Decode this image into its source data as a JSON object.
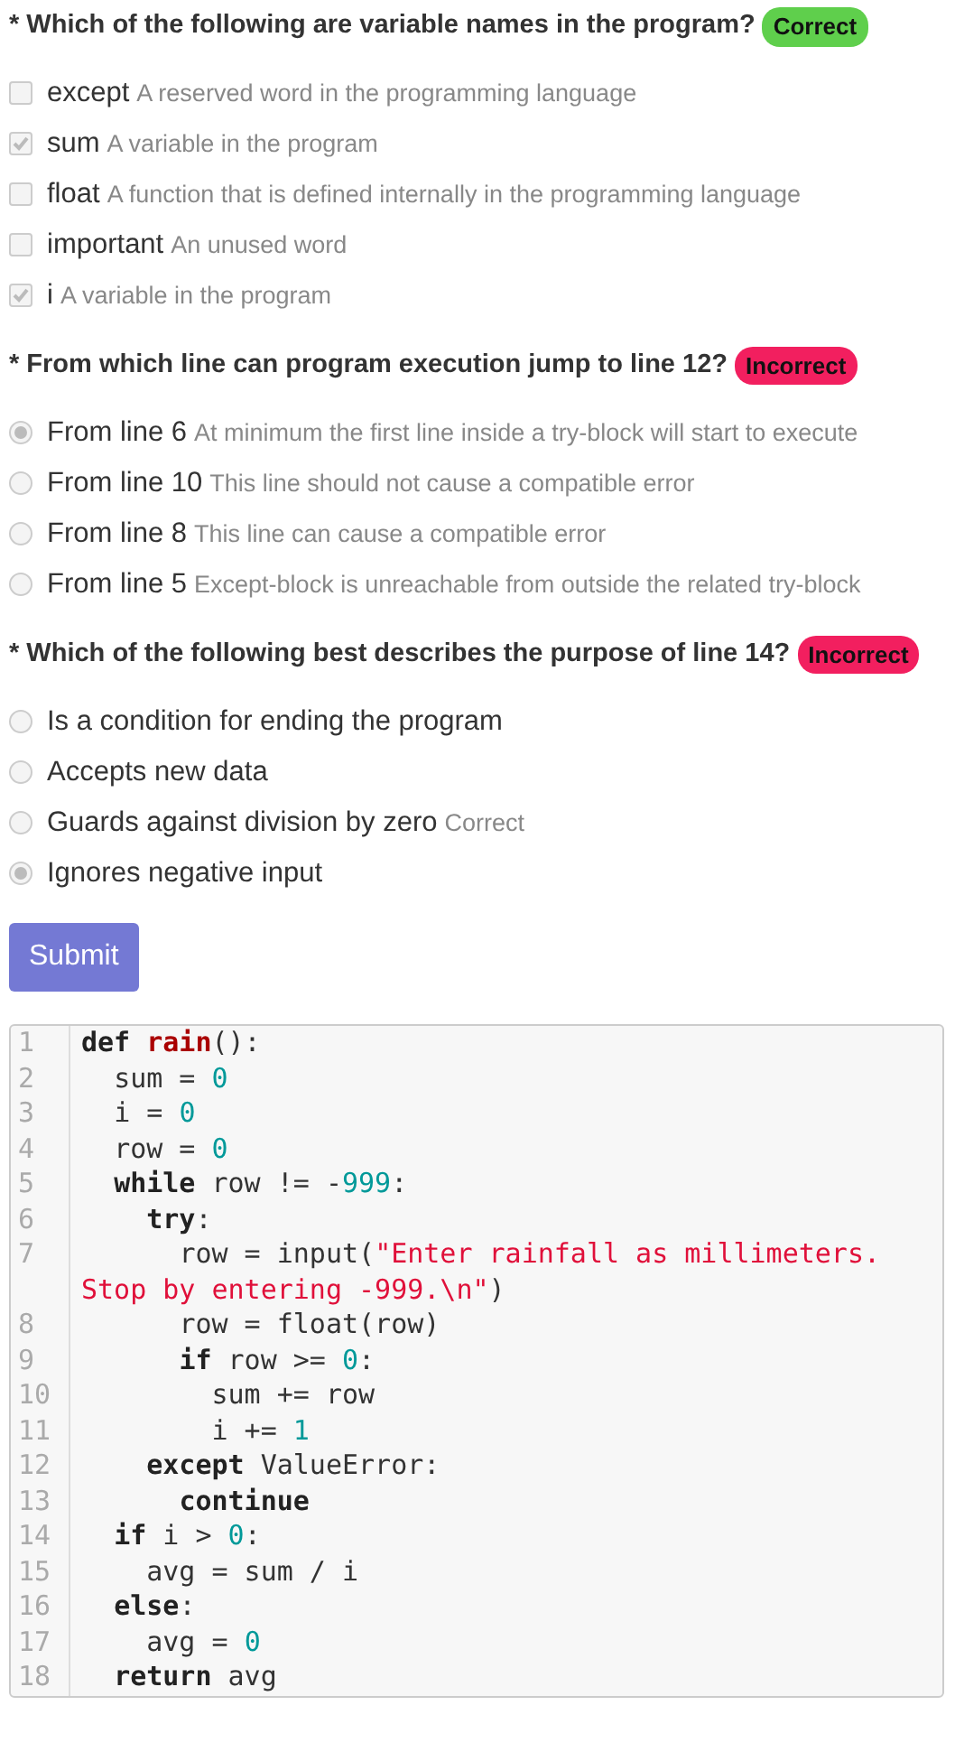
{
  "questions": [
    {
      "prompt": "* Which of the following are variable names in the program?",
      "correct": true,
      "result_label": "Correct",
      "kind": "checkbox",
      "options": [
        {
          "label": "except",
          "feedback": "A reserved word in the programming language",
          "selected": false
        },
        {
          "label": "sum",
          "feedback": "A variable in the program",
          "selected": true
        },
        {
          "label": "float",
          "feedback": "A function that is defined internally in the programming language",
          "selected": false
        },
        {
          "label": "important",
          "feedback": "An unused word",
          "selected": false
        },
        {
          "label": "i",
          "feedback": "A variable in the program",
          "selected": true
        }
      ]
    },
    {
      "prompt": "* From which line can program execution jump to line 12?",
      "correct": false,
      "result_label": "Incorrect",
      "kind": "radio",
      "options": [
        {
          "label": "From line 6",
          "feedback": "At minimum the first line inside a try-block will start to execute",
          "selected": true
        },
        {
          "label": "From line 10",
          "feedback": "This line should not cause a compatible error",
          "selected": false
        },
        {
          "label": "From line 8",
          "feedback": "This line can cause a compatible error",
          "selected": false
        },
        {
          "label": "From line 5",
          "feedback": "Except-block is unreachable from outside the related try-block",
          "selected": false
        }
      ]
    },
    {
      "prompt": "* Which of the following best describes the purpose of line 14?",
      "correct": false,
      "result_label": "Incorrect",
      "kind": "radio",
      "options": [
        {
          "label": "Is a condition for ending the program",
          "selected": false
        },
        {
          "label": "Accepts new data",
          "selected": false
        },
        {
          "label": "Guards against division by zero",
          "feedback": "Correct",
          "selected": false
        },
        {
          "label": "Ignores negative input",
          "selected": true
        }
      ]
    }
  ],
  "submit_button": "Submit",
  "code": [
    {
      "n": "1",
      "tokens": [
        {
          "kind": "keyword",
          "text": "def "
        },
        {
          "kind": "function",
          "text": "rain"
        },
        {
          "kind": "plain",
          "text": "():"
        }
      ]
    },
    {
      "n": "2",
      "tokens": [
        {
          "kind": "plain",
          "text": "  sum = "
        },
        {
          "kind": "number",
          "text": "0"
        }
      ]
    },
    {
      "n": "3",
      "tokens": [
        {
          "kind": "plain",
          "text": "  i = "
        },
        {
          "kind": "number",
          "text": "0"
        }
      ]
    },
    {
      "n": "4",
      "tokens": [
        {
          "kind": "plain",
          "text": "  row = "
        },
        {
          "kind": "number",
          "text": "0"
        }
      ]
    },
    {
      "n": "5",
      "tokens": [
        {
          "kind": "keyword",
          "text": "  while"
        },
        {
          "kind": "plain",
          "text": " row != -"
        },
        {
          "kind": "number",
          "text": "999"
        },
        {
          "kind": "plain",
          "text": ":"
        }
      ]
    },
    {
      "n": "6",
      "tokens": [
        {
          "kind": "keyword",
          "text": "    try"
        },
        {
          "kind": "plain",
          "text": ":"
        }
      ]
    },
    {
      "n": "7",
      "tokens": [
        {
          "kind": "plain",
          "text": "      row = input("
        },
        {
          "kind": "string",
          "text": "\"Enter rainfall as millimeters. Stop by entering -999.\\n\""
        },
        {
          "kind": "plain",
          "text": ")"
        }
      ]
    },
    {
      "n": "8",
      "tokens": [
        {
          "kind": "plain",
          "text": "      row = float(row)"
        }
      ]
    },
    {
      "n": "9",
      "tokens": [
        {
          "kind": "keyword",
          "text": "      if"
        },
        {
          "kind": "plain",
          "text": " row >= "
        },
        {
          "kind": "number",
          "text": "0"
        },
        {
          "kind": "plain",
          "text": ":"
        }
      ]
    },
    {
      "n": "10",
      "tokens": [
        {
          "kind": "plain",
          "text": "        sum += row"
        }
      ]
    },
    {
      "n": "11",
      "tokens": [
        {
          "kind": "plain",
          "text": "        i += "
        },
        {
          "kind": "number",
          "text": "1"
        }
      ]
    },
    {
      "n": "12",
      "tokens": [
        {
          "kind": "keyword",
          "text": "    except"
        },
        {
          "kind": "plain",
          "text": " ValueError:"
        }
      ]
    },
    {
      "n": "13",
      "tokens": [
        {
          "kind": "keyword",
          "text": "      continue"
        }
      ]
    },
    {
      "n": "14",
      "tokens": [
        {
          "kind": "keyword",
          "text": "  if"
        },
        {
          "kind": "plain",
          "text": " i > "
        },
        {
          "kind": "number",
          "text": "0"
        },
        {
          "kind": "plain",
          "text": ":"
        }
      ]
    },
    {
      "n": "15",
      "tokens": [
        {
          "kind": "plain",
          "text": "    avg = sum / i"
        }
      ]
    },
    {
      "n": "16",
      "tokens": [
        {
          "kind": "keyword",
          "text": "  else"
        },
        {
          "kind": "plain",
          "text": ":"
        }
      ]
    },
    {
      "n": "17",
      "tokens": [
        {
          "kind": "plain",
          "text": "    avg = "
        },
        {
          "kind": "number",
          "text": "0"
        }
      ]
    },
    {
      "n": "18",
      "tokens": [
        {
          "kind": "keyword",
          "text": "  return"
        },
        {
          "kind": "plain",
          "text": " avg"
        }
      ]
    }
  ]
}
